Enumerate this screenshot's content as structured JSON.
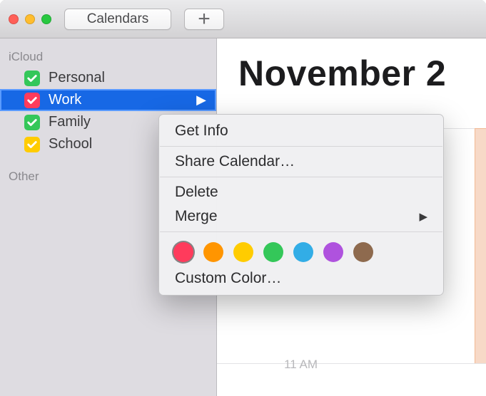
{
  "toolbar": {
    "calendars_label": "Calendars",
    "add_label": "+"
  },
  "sidebar": {
    "groups": [
      {
        "label": "iCloud",
        "items": [
          {
            "label": "Personal",
            "color": "#34c759",
            "selected": false
          },
          {
            "label": "Work",
            "color": "#ff3b5c",
            "selected": true
          },
          {
            "label": "Family",
            "color": "#34c759",
            "selected": false
          },
          {
            "label": "School",
            "color": "#ffcc00",
            "selected": false
          }
        ]
      },
      {
        "label": "Other",
        "items": []
      }
    ]
  },
  "main": {
    "title_visible": "November 2"
  },
  "context_menu": {
    "get_info": "Get Info",
    "share": "Share Calendar…",
    "delete": "Delete",
    "merge": "Merge",
    "custom_color": "Custom Color…",
    "colors": [
      "#ff3b5c",
      "#ff9500",
      "#ffcc00",
      "#34c759",
      "#32ade6",
      "#af52de",
      "#8e6a4e"
    ],
    "selected_color_index": 0
  },
  "time": {
    "label_11am": "11 AM"
  }
}
